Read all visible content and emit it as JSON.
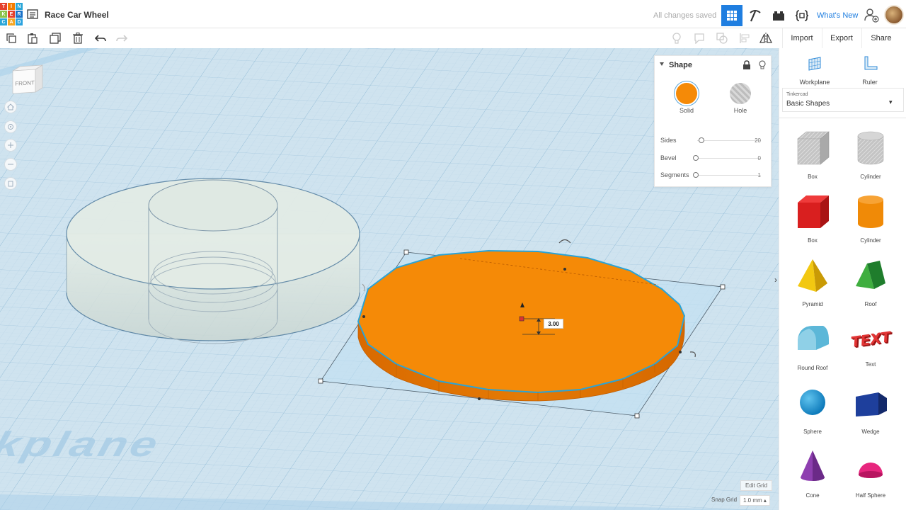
{
  "app": {
    "logo_letters": [
      "T",
      "I",
      "N",
      "K",
      "E",
      "R",
      "C",
      "A",
      "D"
    ],
    "logo_colors": [
      "#e5412c",
      "#f57c00",
      "#2aa6d8",
      "#8bc34a",
      "#e5412c",
      "#1a73c9",
      "#2aa6d8",
      "#f5a623",
      "#2ba2df"
    ],
    "document_title": "Race Car Wheel",
    "save_status": "All changes saved",
    "whats_new_label": "What's New",
    "accent_color": "#1f7ee0"
  },
  "toolbar": {
    "import_label": "Import",
    "export_label": "Export",
    "share_label": "Share"
  },
  "workplane": {
    "watermark_text": "kplane",
    "view_cube_label": "FRONT",
    "selected_height_value": "3.00",
    "edit_grid_label": "Edit Grid",
    "snap_grid_label": "Snap Grid",
    "snap_grid_value": "1.0 mm ▴"
  },
  "inspector": {
    "title": "Shape",
    "solid_label": "Solid",
    "hole_label": "Hole",
    "solid_color": "#f58a07",
    "properties": [
      {
        "label": "Sides",
        "value": "20",
        "fraction": 0.05
      },
      {
        "label": "Bevel",
        "value": "0",
        "fraction": 0.0
      },
      {
        "label": "Segments",
        "value": "1",
        "fraction": 0.0
      }
    ]
  },
  "right_panel": {
    "workplane_label": "Workplane",
    "ruler_label": "Ruler",
    "library_source": "Tinkercad",
    "library_name": "Basic Shapes",
    "shapes": [
      {
        "label": "Box",
        "icon": "box-hole-icon"
      },
      {
        "label": "Cylinder",
        "icon": "cylinder-hole-icon"
      },
      {
        "label": "Box",
        "icon": "box-icon"
      },
      {
        "label": "Cylinder",
        "icon": "cylinder-icon"
      },
      {
        "label": "Pyramid",
        "icon": "pyramid-icon"
      },
      {
        "label": "Roof",
        "icon": "roof-icon"
      },
      {
        "label": "Round Roof",
        "icon": "round-roof-icon"
      },
      {
        "label": "Text",
        "icon": "text-icon"
      },
      {
        "label": "Sphere",
        "icon": "sphere-icon"
      },
      {
        "label": "Wedge",
        "icon": "wedge-icon"
      },
      {
        "label": "Cone",
        "icon": "cone-icon"
      },
      {
        "label": "Half Sphere",
        "icon": "half-sphere-icon"
      }
    ],
    "text_shape_glyphs": "TEXT"
  }
}
